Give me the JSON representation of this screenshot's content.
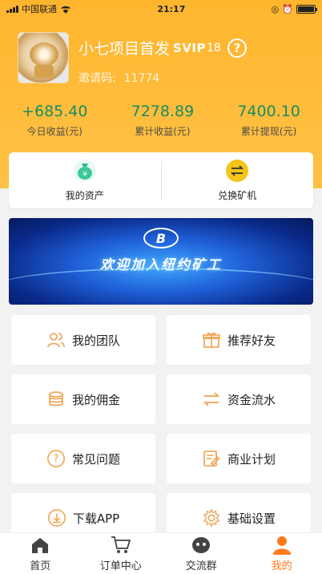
{
  "status_bar": {
    "carrier": "中国联通",
    "time": "21:17"
  },
  "profile": {
    "name": "小七项目首发",
    "vip": "SVIP",
    "vip_level": "18",
    "invite_label": "邀请码:",
    "invite_code": "11774"
  },
  "stats": [
    {
      "value": "+685.40",
      "label": "今日收益(元)"
    },
    {
      "value": "7278.89",
      "label": "累计收益(元)"
    },
    {
      "value": "7400.10",
      "label": "累计提现(元)"
    }
  ],
  "assets": [
    {
      "label": "我的资产",
      "icon": "money-bag-icon"
    },
    {
      "label": "兑换矿机",
      "icon": "exchange-icon"
    }
  ],
  "banner": {
    "title": "欢迎加入纽约矿工"
  },
  "menu": [
    {
      "label": "我的团队",
      "icon": "team-icon"
    },
    {
      "label": "推荐好友",
      "icon": "gift-icon"
    },
    {
      "label": "我的佣金",
      "icon": "coins-icon"
    },
    {
      "label": "资金流水",
      "icon": "transfer-icon"
    },
    {
      "label": "常见问题",
      "icon": "question-icon"
    },
    {
      "label": "商业计划",
      "icon": "plan-icon"
    },
    {
      "label": "下载APP",
      "icon": "download-icon"
    },
    {
      "label": "基础设置",
      "icon": "settings-icon"
    }
  ],
  "tabs": [
    {
      "label": "首页",
      "icon": "home-icon"
    },
    {
      "label": "订单中心",
      "icon": "cart-icon"
    },
    {
      "label": "交流群",
      "icon": "chat-icon"
    },
    {
      "label": "我的",
      "icon": "user-icon",
      "active": true
    }
  ],
  "colors": {
    "accent": "#ff9d2e",
    "header": "#ffb52e",
    "money": "#1a8c62",
    "active_tab": "#ff7a1a"
  }
}
